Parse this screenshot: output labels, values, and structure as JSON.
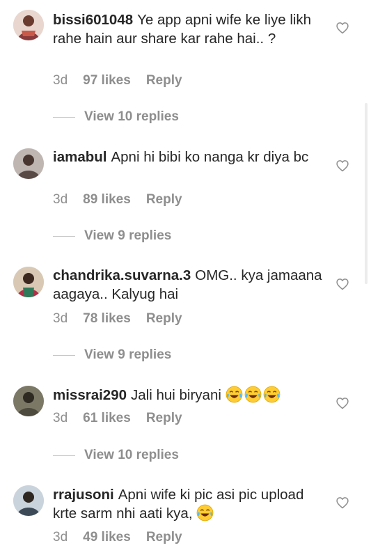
{
  "comments": [
    {
      "username": "bissi601048",
      "text": "Ye app apni wife ke liye likh rahe hain aur share kar rahe hai.. ?",
      "time": "3d",
      "likes": "97 likes",
      "reply_label": "Reply",
      "view_replies": "View 10 replies",
      "avatar_color": "#8a3a3a"
    },
    {
      "username": "iamabul",
      "text": "Apni hi bibi ko nanga kr diya bc",
      "time": "3d",
      "likes": "89 likes",
      "reply_label": "Reply",
      "view_replies": "View 9 replies",
      "avatar_color": "#5a4a46"
    },
    {
      "username": "chandrika.suvarna.3",
      "text": "OMG.. kya jamaana aagaya.. Kalyug hai",
      "time": "3d",
      "likes": "78 likes",
      "reply_label": "Reply",
      "view_replies": "View 9 replies",
      "avatar_color": "#b0304a"
    },
    {
      "username": "missrai290",
      "text": "Jali hui biryani",
      "emoji": [
        "face-with-tears-of-joy",
        "face-with-tears-of-joy",
        "face-with-tears-of-joy"
      ],
      "time": "3d",
      "likes": "61 likes",
      "reply_label": "Reply",
      "view_replies": "View 10 replies",
      "avatar_color": "#4d4a3e"
    },
    {
      "username": "rrajusoni",
      "text": "Apni wife ki pic asi pic upload krte sarm nhi aati kya,",
      "emoji": [
        "face-with-tears-of-joy"
      ],
      "time": "3d",
      "likes": "49 likes",
      "reply_label": "Reply",
      "avatar_color": "#3c4a57"
    }
  ],
  "icons": {
    "like": "heart-outline-icon",
    "emoji": "face-with-tears-of-joy"
  },
  "colors": {
    "text": "#262626",
    "secondary": "#8e8e8e",
    "divider": "#c7c7c7"
  }
}
